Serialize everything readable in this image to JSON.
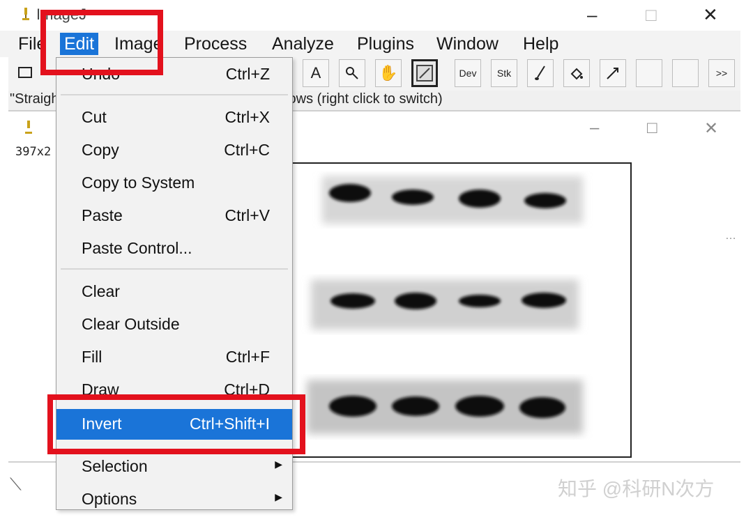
{
  "window": {
    "title": "ImageJ"
  },
  "menubar": [
    "File",
    "Edit",
    "Image",
    "Process",
    "Analyze",
    "Plugins",
    "Window",
    "Help"
  ],
  "active_menu": "Edit",
  "toolbar": {
    "text_tool": "A",
    "dev": "Dev",
    "stk": "Stk",
    "more": ">>"
  },
  "status_text": "\"Straight, segmented or freehand lines, or arrows (right click to switch)",
  "image_window": {
    "info": "397x2"
  },
  "edit_menu": {
    "items": [
      {
        "label": "Undo",
        "shortcut": "Ctrl+Z"
      },
      {
        "label": "Cut",
        "shortcut": "Ctrl+X"
      },
      {
        "label": "Copy",
        "shortcut": "Ctrl+C"
      },
      {
        "label": "Copy to System",
        "shortcut": ""
      },
      {
        "label": "Paste",
        "shortcut": "Ctrl+V"
      },
      {
        "label": "Paste Control...",
        "shortcut": ""
      },
      {
        "label": "Clear",
        "shortcut": ""
      },
      {
        "label": "Clear Outside",
        "shortcut": ""
      },
      {
        "label": "Fill",
        "shortcut": "Ctrl+F"
      },
      {
        "label": "Draw",
        "shortcut": "Ctrl+D"
      },
      {
        "label": "Invert",
        "shortcut": "Ctrl+Shift+I"
      },
      {
        "label": "Selection",
        "shortcut": ""
      },
      {
        "label": "Options",
        "shortcut": ""
      }
    ],
    "selected": "Invert"
  },
  "watermark": "知乎 @科研N次方",
  "colors": {
    "menu_highlight": "#1a74d8",
    "annotation": "#e3111d"
  }
}
